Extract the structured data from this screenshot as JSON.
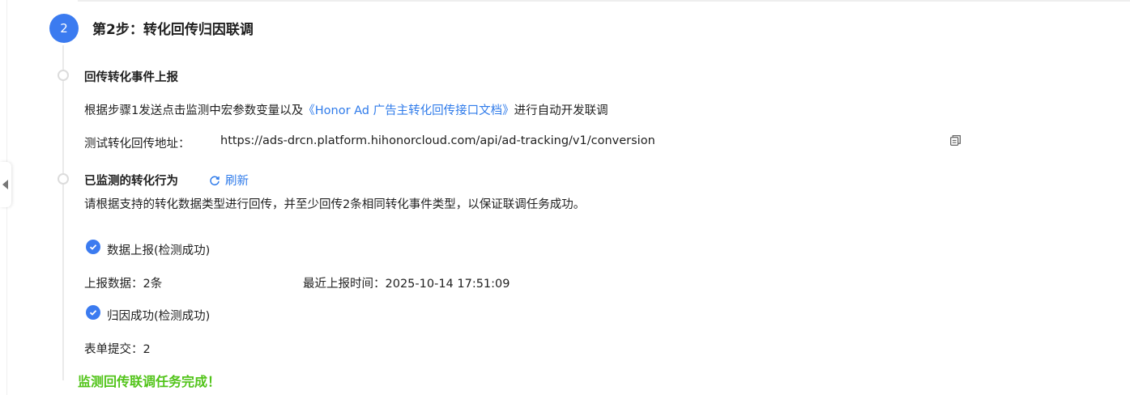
{
  "step": {
    "number": "2",
    "title": "第2步：转化回传归因联调"
  },
  "conversion_section": {
    "heading": "回传转化事件上报",
    "desc_prefix": "根据步骤1发送点击监测中宏参数变量以及",
    "doc_link": "《Honor Ad 广告主转化回传接口文档》",
    "desc_suffix": "进行自动开发联调",
    "test_url_label": "测试转化回传地址：",
    "test_url": "https://ads-drcn.platform.hihonorcloud.com/api/ad-tracking/v1/conversion"
  },
  "monitor_section": {
    "heading": "已监测的转化行为",
    "refresh_label": "刷新",
    "desc": "请根据支持的转化数据类型进行回传，并至少回传2条相同转化事件类型，以保证联调任务成功。"
  },
  "results": {
    "data_report_status": "数据上报(检测成功)",
    "report_count": "上报数据：2条",
    "last_report_time": "最近上报时间：2025-10-14 17:51:09",
    "attribution_status": "归因成功(检测成功)",
    "form_submit": "表单提交：2"
  },
  "completion_text": "监测回传联调任务完成！",
  "colors": {
    "accent": "#3b7bf0",
    "link": "#2f7bea",
    "success": "#52c41a"
  },
  "icons": [
    "copy-icon",
    "refresh-icon",
    "check-circle-icon",
    "collapse-arrow-icon"
  ]
}
